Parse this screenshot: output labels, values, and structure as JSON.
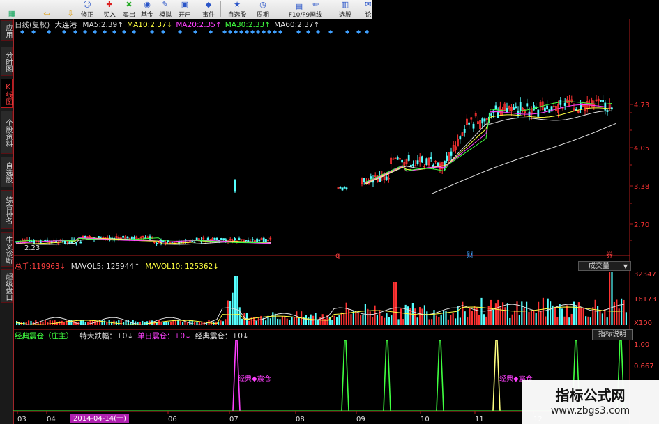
{
  "toolbar": {
    "buttons": [
      {
        "label": "",
        "icon": "home-grid-icon"
      },
      {
        "label": "",
        "icon": "back-arrow-icon"
      },
      {
        "label": "",
        "icon": "down-arrow-icon"
      },
      {
        "label": "修正",
        "icon": "smile-icon"
      },
      {
        "label": "买入",
        "icon": "buy-icon"
      },
      {
        "label": "卖出",
        "icon": "sell-icon"
      },
      {
        "label": "基金",
        "icon": "fund-icon"
      },
      {
        "label": "模拟",
        "icon": "simulate-icon"
      },
      {
        "label": "开户",
        "icon": "account-icon"
      },
      {
        "label": "事件",
        "icon": "event-icon"
      },
      {
        "label": "自选股",
        "icon": "watchlist-icon"
      },
      {
        "label": "周期",
        "icon": "period-icon"
      },
      {
        "label": "F10/F9",
        "icon": "f10-icon"
      },
      {
        "label": "画线",
        "icon": "draw-icon"
      },
      {
        "label": "选股",
        "icon": "select-stock-icon"
      },
      {
        "label": "论",
        "icon": "forum-icon"
      }
    ]
  },
  "leftnav": {
    "tabs": [
      "应用",
      "分时图",
      "K线图",
      "个股资料",
      "自选股",
      "综合排名",
      "牛叉诊断",
      "超级盘口"
    ]
  },
  "kline": {
    "period": "日线(复权)",
    "stock": "大连港",
    "ma": [
      {
        "label": "MA5:",
        "value": "2.39↑",
        "color": "#e0e0e0"
      },
      {
        "label": "MA10:",
        "value": "2.37↓",
        "color": "#ffff40"
      },
      {
        "label": "MA20:",
        "value": "2.35↑",
        "color": "#ff40ff"
      },
      {
        "label": "MA30:",
        "value": "2.33↑",
        "color": "#40ff40"
      },
      {
        "label": "MA60:",
        "value": "2.37↑",
        "color": "#e0e0e0"
      }
    ],
    "y_ticks": [
      "4.73",
      "4.05",
      "3.38",
      "2.70"
    ],
    "low_label": "2.23",
    "markers": [
      "q",
      "财",
      "券"
    ]
  },
  "volume": {
    "title_prefix": "总手:",
    "title_value": "119963↓",
    "mavol5": "MAVOL5: 125944↑",
    "mavol10": "MAVOL10: 125362↓",
    "dropdown": "成交量",
    "y_ticks": [
      "32347",
      "16173",
      "X100"
    ]
  },
  "indicator": {
    "name": "经典震仓（庄主）",
    "items": [
      {
        "text": "特大跌幅：+0↓",
        "color": "#e0e0e0"
      },
      {
        "text": "单日震仓：+0↓",
        "color": "#ff40ff"
      },
      {
        "text": "经典震仓：+0↓",
        "color": "#e0e0e0"
      }
    ],
    "button": "指标说明",
    "y_ticks": [
      "1.00",
      "0.667"
    ],
    "annotations": [
      "经典◆震仓",
      "经典◆震仓"
    ]
  },
  "xaxis": {
    "labels": [
      "03",
      "04",
      "2014-04-14(一)",
      "06",
      "07",
      "08",
      "09",
      "10",
      "11",
      "12"
    ]
  },
  "watermark": {
    "title": "指标公式网",
    "url": "www.zbgs3.com"
  },
  "colors": {
    "up": "#ff3232",
    "down": "#54ffff",
    "axis": "#b01c1c"
  }
}
